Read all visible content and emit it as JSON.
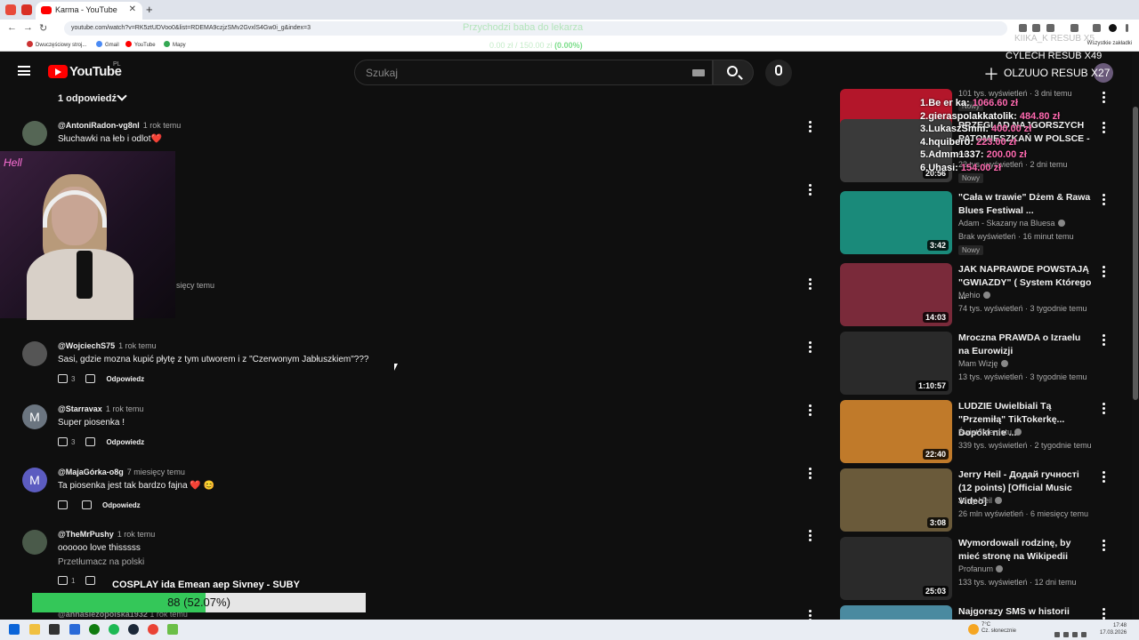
{
  "browser": {
    "tab_title": "Karma - YouTube",
    "url": "youtube.com/watch?v=RK5ztUDVoo0&list=RDEMA9czjzSMv2GvxlS4Gw0i_g&index=3",
    "bookmarks": [
      "Dwuczęściowy stroj...",
      "Gmail",
      "YouTube",
      "Mapy"
    ],
    "bookmarks_right": "Wszystkie zakładki"
  },
  "overlays": {
    "center_title": "Przychodzi baba do lekarza",
    "center_sub_prefix": "0.00 zł / 150.00 zł",
    "center_sub_pct": "(0.00%)",
    "kiika": "KIIKA_K  RESUB X5",
    "cylech": "CYLECH  RESUB X49",
    "olzuuo": "OLZUUO  RESUB X27",
    "leaderboard": [
      {
        "rank": "1.",
        "name": "Be  er ka:",
        "value": "1066.60 zł"
      },
      {
        "rank": "2.",
        "name": "gieraspolakkatolik:",
        "value": "484.80 zł"
      },
      {
        "rank": "3.",
        "name": "LukaszSmm:",
        "value": "400.00 zł"
      },
      {
        "rank": "4.",
        "name": "hquibero:",
        "value": "223.00 zł"
      },
      {
        "rank": "5.",
        "name": "Admm1337:",
        "value": "200.00 zł"
      },
      {
        "rank": "6.",
        "name": "Uhasi:",
        "value": "154.00 zł"
      }
    ],
    "bottom_title": "COSPLAY ida Emean aep Sivney - SUBY",
    "progress_label": "88 (52.07%)",
    "progress_pct": 52.07
  },
  "youtube": {
    "logo": "YouTube",
    "region": "PL",
    "search_placeholder": "Szukaj",
    "replies_toggle": "1 odpowiedź",
    "reply_label": "Odpowiedz",
    "translate_label": "Przetłumacz na polski",
    "webcam_partial_time": "sięcy temu",
    "comments": [
      {
        "author": "@AntoniRadon-vg8nl",
        "time": "1 rok temu",
        "text": "Słuchawki na łeb i odlot❤️",
        "likes": "",
        "avatar_color": "#556655"
      },
      {
        "author": "@WojciechS75",
        "time": "1 rok temu",
        "text": "Sasi, gdzie mozna kupić płytę z tym utworem i z \"Czerwonym Jabłuszkiem\"???",
        "likes": "3",
        "avatar_color": "#555"
      },
      {
        "author": "@Starravax",
        "time": "1 rok temu",
        "text": "Super piosenka !",
        "likes": "3",
        "avatar_color": "#6b7580"
      },
      {
        "author": "@MajaGórka-o8g",
        "time": "7 miesięcy temu",
        "text": "Ta piosenka jest tak bardzo fajna ❤️ 😊",
        "likes": "",
        "avatar_color": "#5c5cc0"
      },
      {
        "author": "@TheMrPushy",
        "time": "1 rok temu",
        "text": "oooooo love thisssss",
        "likes": "1",
        "avatar_color": "#4a5a4a"
      }
    ],
    "partial_bottom_author": "@annasiezopolska1932",
    "partial_bottom_time": "1 rok temu",
    "sidebar": [
      {
        "title": "",
        "channel": "",
        "meta": "101 tys. wyświetleń · 3 dni temu",
        "duration": "",
        "new": "Nowy",
        "color": "#b3162a"
      },
      {
        "title": "PRZEGLĄD NAJGORSZYCH PATOMIESZKAŃ W POLSCE - ...",
        "channel": "",
        "meta": "23 tys. wyświetleń · 2 dni temu",
        "duration": "20:56",
        "new": "Nowy",
        "color": "#3a3a3a"
      },
      {
        "title": "\"Cała w trawie\"         Dżem & Rawa Blues Festiwal ...",
        "channel": "Adam - Skazany na Bluesa",
        "meta": "Brak wyświetleń · 16 minut temu",
        "duration": "3:42",
        "new": "Nowy",
        "color": "#1a8a7a"
      },
      {
        "title": "JAK NAPRAWDE POWSTAJĄ \"GWIAZDY\" ( System Którego ...",
        "channel": "Mehio",
        "meta": "74 tys. wyświetleń · 3 tygodnie temu",
        "duration": "14:03",
        "new": "",
        "color": "#7a2a3a"
      },
      {
        "title": "Mroczna PRAWDA o Izraelu na Eurowizji",
        "channel": "Mam Wizję",
        "meta": "13 tys. wyświetleń · 3 tygodnie temu",
        "duration": "1:10:57",
        "new": "",
        "color": "#2a2a2a"
      },
      {
        "title": "LUDZIE Uwielbiali Tą \"Przemiłą\" TikTokerkę... Dopóki nie ...",
        "channel": "Świat Internetu",
        "meta": "339 tys. wyświetleń · 2 tygodnie temu",
        "duration": "22:40",
        "new": "",
        "color": "#c07a2a"
      },
      {
        "title": "Jerry Heil -  Додай гучності (12 points) [Official Music Video]",
        "channel": "Jerry Heil",
        "meta": "26 mln wyświetleń · 6 miesięcy temu",
        "duration": "3:08",
        "new": "",
        "color": "#6a5a3a"
      },
      {
        "title": "Wymordowali rodzinę, by mieć stronę na Wikipedii",
        "channel": "Profanum",
        "meta": "133 tys. wyświetleń · 12 dni temu",
        "duration": "25:03",
        "new": "",
        "color": "#2a2a2a"
      },
      {
        "title": "Najgorszy SMS w historii",
        "channel": "",
        "meta": "",
        "duration": "",
        "new": "",
        "color": "#4a8aa0"
      }
    ]
  },
  "webcam": {
    "neon": "Hell"
  },
  "taskbar": {
    "weather": "7°C",
    "weather_desc": "Cz. słonecznie",
    "time": "17:48",
    "date": "17.03.2026"
  }
}
